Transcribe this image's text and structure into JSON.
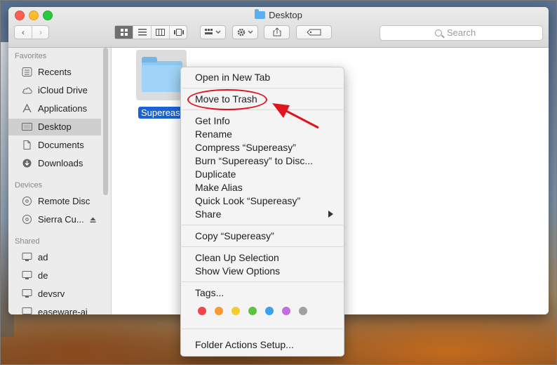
{
  "window": {
    "title": "Desktop"
  },
  "toolbar": {
    "back_label": "‹",
    "forward_label": "›",
    "search_placeholder": "Search"
  },
  "sidebar": {
    "favorites_header": "Favorites",
    "favorites": [
      {
        "label": "Recents",
        "icon": "recents-icon"
      },
      {
        "label": "iCloud Drive",
        "icon": "cloud-icon"
      },
      {
        "label": "Applications",
        "icon": "applications-icon"
      },
      {
        "label": "Desktop",
        "icon": "desktop-icon",
        "selected": true
      },
      {
        "label": "Documents",
        "icon": "document-icon"
      },
      {
        "label": "Downloads",
        "icon": "download-icon"
      }
    ],
    "devices_header": "Devices",
    "devices": [
      {
        "label": "Remote Disc",
        "icon": "disc-icon"
      },
      {
        "label": "Sierra Cu...",
        "icon": "disc-icon"
      }
    ],
    "shared_header": "Shared",
    "shared": [
      {
        "label": "ad",
        "icon": "display-icon"
      },
      {
        "label": "de",
        "icon": "display-icon"
      },
      {
        "label": "devsrv",
        "icon": "display-icon"
      },
      {
        "label": "easeware-ai",
        "icon": "display-icon"
      }
    ]
  },
  "content": {
    "file_name": "Supereasy"
  },
  "context_menu": {
    "items": [
      "Open in New Tab",
      "Move to Trash",
      "Get Info",
      "Rename",
      "Compress “Supereasy”",
      "Burn “Supereasy” to Disc...",
      "Duplicate",
      "Make Alias",
      "Quick Look “Supereasy”",
      "Share",
      "Copy “Supereasy”",
      "Clean Up Selection",
      "Show View Options",
      "Tags...",
      "Folder Actions Setup..."
    ],
    "tag_colors": [
      "#f0484a",
      "#f59b32",
      "#f2cd30",
      "#5ec13f",
      "#3aa1ec",
      "#c16fdf",
      "#a0a0a0"
    ]
  },
  "colors": {
    "highlight": "#e0141e",
    "selection": "#1a63d6"
  }
}
